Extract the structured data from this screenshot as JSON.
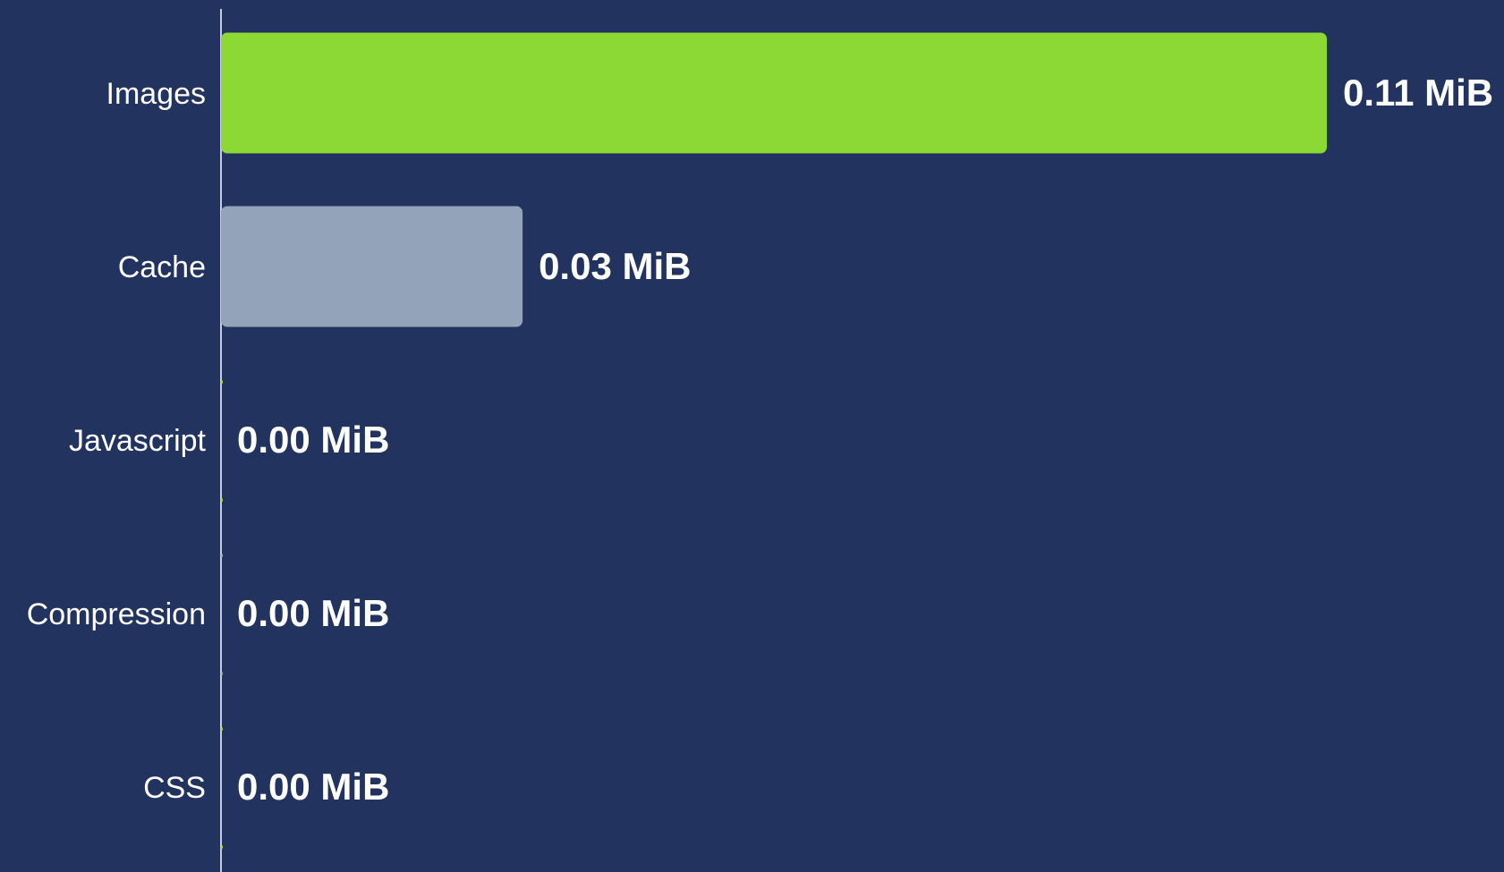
{
  "chart_data": {
    "type": "bar",
    "orientation": "horizontal",
    "categories": [
      "Images",
      "Cache",
      "Javascript",
      "Compression",
      "CSS"
    ],
    "values": [
      0.11,
      0.03,
      0.0,
      0.0,
      0.0
    ],
    "value_labels": [
      "0.11 MiB",
      "0.03 MiB",
      "0.00 MiB",
      "0.00 MiB",
      "0.00 MiB"
    ],
    "unit": "MiB",
    "xlim": [
      0,
      0.11
    ],
    "title": "",
    "xlabel": "",
    "ylabel": "",
    "grid": false,
    "legend": "none",
    "colors": {
      "background": "#22335f",
      "axis": "#c8ccd8",
      "text": "#ffffff",
      "bars": [
        "#8cd936",
        "#93a3ba",
        "#8cd936",
        "#93a3ba",
        "#8cd936"
      ]
    }
  }
}
